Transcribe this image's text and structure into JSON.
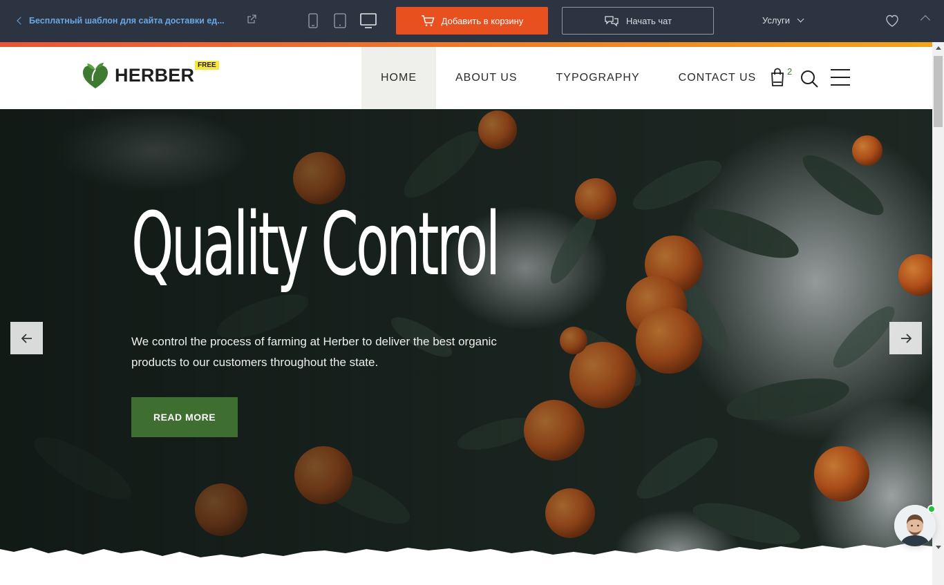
{
  "topbar": {
    "back_label": "Бесплатный шаблон для сайта доставки ед...",
    "add_to_cart_label": "Добавить в корзину",
    "chat_label": "Начать чат",
    "services_label": "Услуги",
    "icons": [
      "chevron-left-icon",
      "external-link-icon",
      "mobile-icon",
      "tablet-icon",
      "desktop-icon",
      "cart-icon",
      "chat-icon",
      "chevron-down-icon",
      "heart-icon",
      "chevron-up-icon"
    ],
    "colors": {
      "background": "#2b3440",
      "cart_button": "#e8501f",
      "link": "#6aa7e6"
    }
  },
  "site": {
    "logo_text": "HERBER",
    "logo_badge": "FREE",
    "nav": [
      {
        "label": "HOME",
        "active": true
      },
      {
        "label": "ABOUT US",
        "active": false
      },
      {
        "label": "TYPOGRAPHY",
        "active": false
      },
      {
        "label": "CONTACT US",
        "active": false
      }
    ],
    "cart_count": "2",
    "colors": {
      "accent_green": "#3e6f30",
      "strip_start": "#e8553a",
      "strip_end": "#f1a51c"
    }
  },
  "hero": {
    "title": "Quality Control",
    "description": "We control the process of farming at Herber to deliver the best organic products to our customers throughout the state.",
    "button_label": "READ MORE"
  }
}
